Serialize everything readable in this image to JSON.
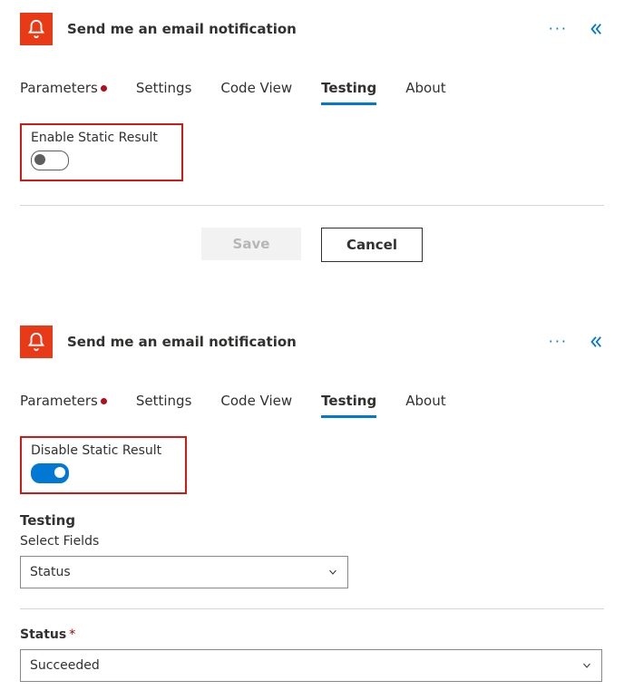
{
  "panel1": {
    "title": "Send me an email notification",
    "tabs": [
      {
        "label": "Parameters",
        "hasDot": true
      },
      {
        "label": "Settings"
      },
      {
        "label": "Code View"
      },
      {
        "label": "Testing",
        "active": true
      },
      {
        "label": "About"
      }
    ],
    "toggle": {
      "label": "Enable Static Result",
      "on": false
    },
    "buttons": {
      "save": "Save",
      "cancel": "Cancel"
    }
  },
  "panel2": {
    "title": "Send me an email notification",
    "tabs": [
      {
        "label": "Parameters",
        "hasDot": true
      },
      {
        "label": "Settings"
      },
      {
        "label": "Code View"
      },
      {
        "label": "Testing",
        "active": true
      },
      {
        "label": "About"
      }
    ],
    "toggle": {
      "label": "Disable Static Result",
      "on": true
    },
    "section": {
      "heading": "Testing",
      "selectFields": {
        "label": "Select Fields",
        "value": "Status"
      },
      "status": {
        "label": "Status",
        "required": true,
        "value": "Succeeded"
      }
    }
  }
}
